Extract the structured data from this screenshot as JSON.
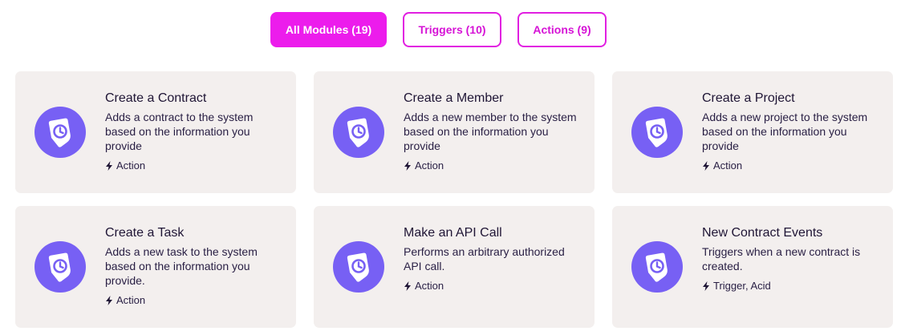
{
  "filters": [
    {
      "label": "All Modules (19)",
      "active": true
    },
    {
      "label": "Triggers (10)",
      "active": false
    },
    {
      "label": "Actions (9)",
      "active": false
    }
  ],
  "cards": [
    {
      "title": "Create a Contract",
      "description": "Adds a contract to the system based on the information you provide",
      "tag": "Action",
      "icon": "app-logo-icon"
    },
    {
      "title": "Create a Member",
      "description": "Adds a new member to the system based on the information you provide",
      "tag": "Action",
      "icon": "app-logo-icon"
    },
    {
      "title": "Create a Project",
      "description": "Adds a new project to the system based on the information you provide",
      "tag": "Action",
      "icon": "app-logo-icon"
    },
    {
      "title": "Create a Task",
      "description": "Adds a new task to the system based on the information you provide.",
      "tag": "Action",
      "icon": "app-logo-icon"
    },
    {
      "title": "Make an API Call",
      "description": "Performs an arbitrary authorized API call.",
      "tag": "Action",
      "icon": "app-logo-icon"
    },
    {
      "title": "New Contract Events",
      "description": "Triggers when a new contract is created.",
      "tag": "Trigger, Acid",
      "icon": "app-logo-icon"
    }
  ],
  "colors": {
    "accent": "#ec1cec",
    "icon_bg": "#7760f4",
    "card_bg": "#f3efee"
  }
}
